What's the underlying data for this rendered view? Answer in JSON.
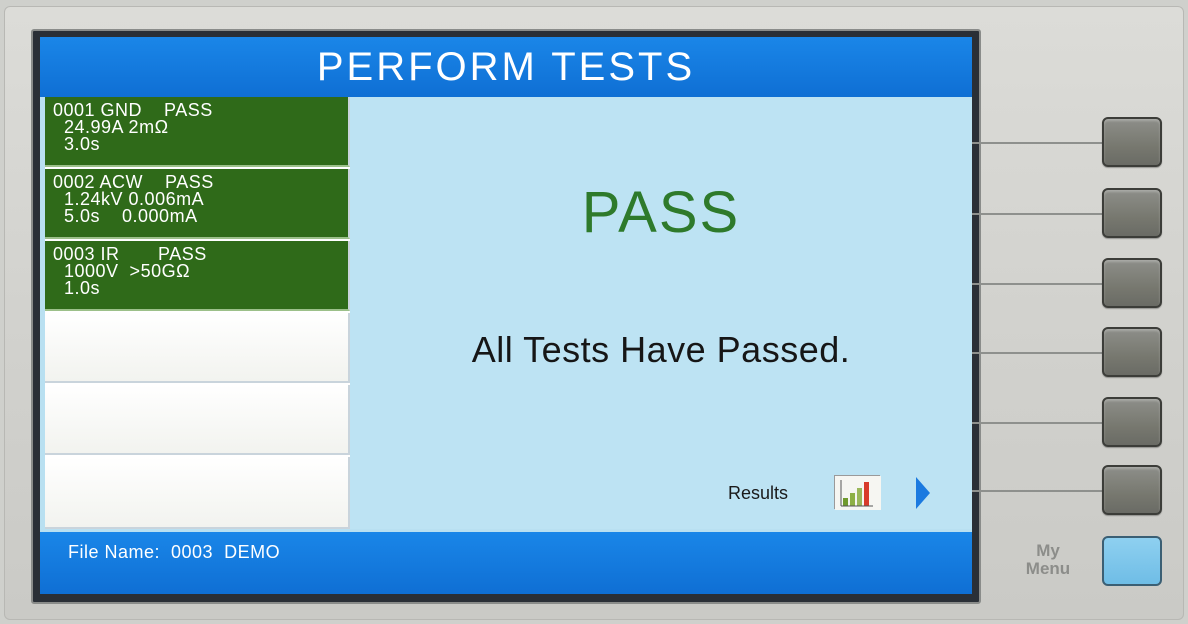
{
  "header": {
    "title": "PERFORM TESTS"
  },
  "steps": [
    {
      "line1": "0001 GND    PASS",
      "line2": "  24.99A 2mΩ",
      "line3": "  3.0s"
    },
    {
      "line1": "0002 ACW    PASS",
      "line2": "  1.24kV 0.006mA",
      "line3": "  5.0s    0.000mA"
    },
    {
      "line1": "0003 IR       PASS",
      "line2": "  1000V  >50GΩ",
      "line3": "  1.0s"
    }
  ],
  "result": {
    "status": "PASS",
    "message": "All Tests Have Passed.",
    "results_label": "Results"
  },
  "status_bar": {
    "file_name": "File Name:  0003  DEMO"
  },
  "softkeys": {
    "my_menu_label": "My Menu"
  },
  "colors": {
    "title_blue": "#1a86e8",
    "pass_green_bg": "#2f6a19",
    "pass_text_green": "#2e7a2b",
    "screen_bg": "#bde3f3",
    "my_menu_key": "#7cc6ec"
  },
  "icons": [
    "bar-chart-icon",
    "right-arrow-icon"
  ]
}
